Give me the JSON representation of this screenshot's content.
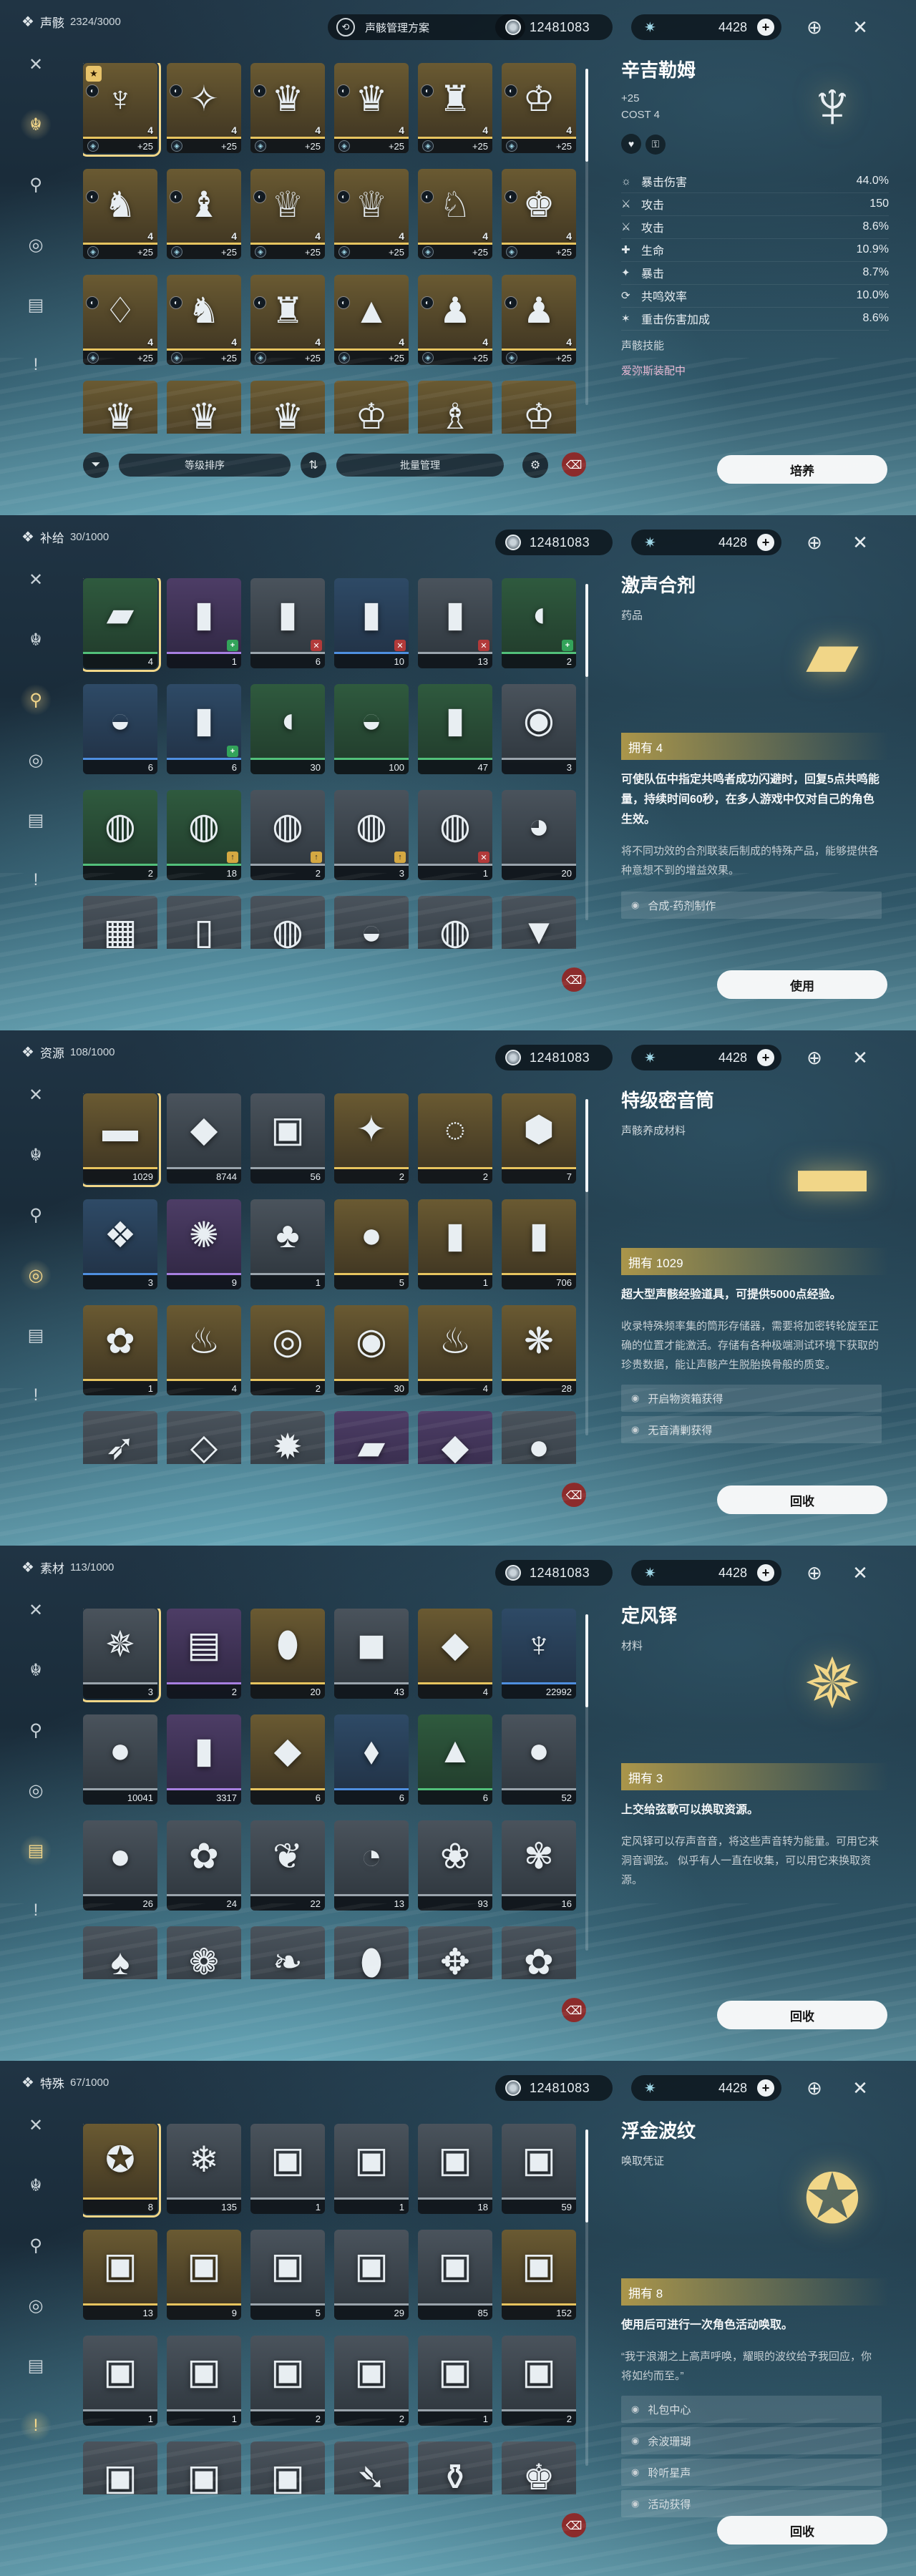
{
  "panels": [
    {
      "category": {
        "icon": "echo-icon",
        "label": "声骸",
        "count": "2324/3000"
      },
      "scheme_label": "声骸管理方案",
      "currency": "12481083",
      "energy": "4428",
      "detail": {
        "name": "辛吉勒姆",
        "level": "+25",
        "cost": "COST 4",
        "stats": [
          {
            "icon": "☼",
            "label": "暴击伤害",
            "value": "44.0%"
          },
          {
            "icon": "⚔",
            "label": "攻击",
            "value": "150"
          },
          {
            "icon": "⚔",
            "label": "攻击",
            "value": "8.6%"
          },
          {
            "icon": "✚",
            "label": "生命",
            "value": "10.9%"
          },
          {
            "icon": "✦",
            "label": "暴击",
            "value": "8.7%"
          },
          {
            "icon": "⟳",
            "label": "共鸣效率",
            "value": "10.0%"
          },
          {
            "icon": "✶",
            "label": "重击伤害加成",
            "value": "8.6%"
          }
        ],
        "skill_label": "声骸技能",
        "equipped": "爱弥斯装配中"
      },
      "bottom": {
        "sort_label": "等级排序",
        "batch_label": "批量管理"
      },
      "action": "培养",
      "items": [
        {
          "q": "q5",
          "art": "♆",
          "cost": "4",
          "lv": "+25",
          "badge": "★",
          "sel": true
        },
        {
          "q": "q5",
          "art": "✧",
          "cost": "4",
          "lv": "+25"
        },
        {
          "q": "q5",
          "art": "♛",
          "cost": "4",
          "lv": "+25"
        },
        {
          "q": "q5",
          "art": "♛",
          "cost": "4",
          "lv": "+25"
        },
        {
          "q": "q5",
          "art": "♜",
          "cost": "4",
          "lv": "+25"
        },
        {
          "q": "q5",
          "art": "♔",
          "cost": "4",
          "lv": "+25"
        },
        {
          "q": "q5",
          "art": "♞",
          "cost": "4",
          "lv": "+25"
        },
        {
          "q": "q5",
          "art": "♝",
          "cost": "4",
          "lv": "+25"
        },
        {
          "q": "q5",
          "art": "♕",
          "cost": "4",
          "lv": "+25"
        },
        {
          "q": "q5",
          "art": "♕",
          "cost": "4",
          "lv": "+25"
        },
        {
          "q": "q5",
          "art": "♘",
          "cost": "4",
          "lv": "+25"
        },
        {
          "q": "q5",
          "art": "♚",
          "cost": "4",
          "lv": "+25"
        },
        {
          "q": "q5",
          "art": "♢",
          "cost": "4",
          "lv": "+25"
        },
        {
          "q": "q5",
          "art": "♞",
          "cost": "4",
          "lv": "+25"
        },
        {
          "q": "q5",
          "art": "♜",
          "cost": "4",
          "lv": "+25"
        },
        {
          "q": "q5",
          "art": "▲",
          "cost": "4",
          "lv": "+25"
        },
        {
          "q": "q5",
          "art": "♟",
          "cost": "4",
          "lv": "+25"
        },
        {
          "q": "q5",
          "art": "♟",
          "cost": "4",
          "lv": "+25"
        },
        {
          "q": "q5",
          "art": "♛",
          "cost": "",
          "": ""
        },
        {
          "q": "q5",
          "art": "♛",
          "cost": ""
        },
        {
          "q": "q5",
          "art": "♛",
          "cost": ""
        },
        {
          "q": "q5",
          "art": "♔",
          "cost": ""
        },
        {
          "q": "q5",
          "art": "♗",
          "cost": ""
        },
        {
          "q": "q5",
          "art": "♔",
          "cost": ""
        }
      ]
    },
    {
      "category": {
        "icon": "supply-icon",
        "label": "补给",
        "count": "30/1000"
      },
      "currency": "12481083",
      "energy": "4428",
      "detail": {
        "name": "激声合剂",
        "sub": "药品",
        "art": "▰",
        "own": "拥有 4",
        "desc": "可使队伍中指定共鸣者成功闪避时，回复5点共鸣能量，持续时间60秒，在多人游戏中仅对自己的角色生效。",
        "lore": "将不同功效的合剂联装后制成的特殊产品，能够提供各种意想不到的增益效果。",
        "sources": [
          "合成-药剂制作"
        ]
      },
      "action": "使用",
      "items": [
        {
          "q": "q2",
          "art": "▰",
          "count": "4",
          "sel": true
        },
        {
          "q": "q4",
          "art": "▮",
          "count": "1",
          "tag": "green"
        },
        {
          "q": "q1",
          "art": "▮",
          "count": "6",
          "tag": "red"
        },
        {
          "q": "q3",
          "art": "▮",
          "count": "10",
          "tag": "red"
        },
        {
          "q": "q1",
          "art": "▮",
          "count": "13",
          "tag": "red"
        },
        {
          "q": "q2",
          "art": "◖",
          "count": "2",
          "tag": "green"
        },
        {
          "q": "q3",
          "art": "◒",
          "count": "6"
        },
        {
          "q": "q3",
          "art": "▮",
          "count": "6",
          "tag": "green"
        },
        {
          "q": "q2",
          "art": "◖",
          "count": "30"
        },
        {
          "q": "q2",
          "art": "◒",
          "count": "100"
        },
        {
          "q": "q2",
          "art": "▮",
          "count": "47"
        },
        {
          "q": "q1",
          "art": "◉",
          "count": "3"
        },
        {
          "q": "q2",
          "art": "◍",
          "count": "2"
        },
        {
          "q": "q2",
          "art": "◍",
          "count": "18",
          "tag": "gold"
        },
        {
          "q": "q1",
          "art": "◍",
          "count": "2",
          "tag": "gold"
        },
        {
          "q": "q1",
          "art": "◍",
          "count": "3",
          "tag": "gold"
        },
        {
          "q": "q1",
          "art": "◍",
          "count": "1",
          "tag": "red"
        },
        {
          "q": "q1",
          "art": "◕",
          "count": "20"
        },
        {
          "q": "q1",
          "art": "▦",
          "count": "",
          "tag": "red"
        },
        {
          "q": "q1",
          "art": "▯",
          "count": ""
        },
        {
          "q": "q1",
          "art": "◍",
          "count": ""
        },
        {
          "q": "q1",
          "art": "◒",
          "count": ""
        },
        {
          "q": "q1",
          "art": "◍",
          "count": ""
        },
        {
          "q": "q1",
          "art": "▼",
          "count": ""
        }
      ]
    },
    {
      "category": {
        "icon": "resource-icon",
        "label": "资源",
        "count": "108/1000"
      },
      "currency": "12481083",
      "energy": "4428",
      "detail": {
        "name": "特级密音筒",
        "sub": "声骸养成材料",
        "art": "▬",
        "own": "拥有 1029",
        "desc": "超大型声骸经验道具，可提供5000点经验。",
        "lore": "收录特殊频率集的筒形存储器，需要将加密转轮旋至正确的位置才能激活。存储有各种极端测试环境下获取的珍贵数据，能让声骸产生脱胎换骨般的质变。",
        "sources": [
          "开启物资箱获得",
          "无音清剿获得"
        ]
      },
      "action": "回收",
      "items": [
        {
          "q": "q5",
          "art": "▬",
          "count": "1029",
          "sel": true
        },
        {
          "q": "q1",
          "art": "◆",
          "count": "8744"
        },
        {
          "q": "q1",
          "art": "▣",
          "count": "56"
        },
        {
          "q": "q5",
          "art": "✦",
          "count": "2"
        },
        {
          "q": "q5",
          "art": "◌",
          "count": "2"
        },
        {
          "q": "q5",
          "art": "⬢",
          "count": "7"
        },
        {
          "q": "q3",
          "art": "❖",
          "count": "3"
        },
        {
          "q": "q4",
          "art": "✺",
          "count": "9"
        },
        {
          "q": "q1",
          "art": "♣",
          "count": "1"
        },
        {
          "q": "q5",
          "art": "●",
          "count": "5"
        },
        {
          "q": "q5",
          "art": "▮",
          "count": "1"
        },
        {
          "q": "q5",
          "art": "▮",
          "count": "706"
        },
        {
          "q": "q5",
          "art": "✿",
          "count": "1"
        },
        {
          "q": "q5",
          "art": "♨",
          "count": "4"
        },
        {
          "q": "q5",
          "art": "◎",
          "count": "2"
        },
        {
          "q": "q5",
          "art": "◉",
          "count": "30"
        },
        {
          "q": "q5",
          "art": "♨",
          "count": "4"
        },
        {
          "q": "q5",
          "art": "❋",
          "count": "28"
        },
        {
          "q": "q1",
          "art": "➶",
          "count": ""
        },
        {
          "q": "q1",
          "art": "◇",
          "count": ""
        },
        {
          "q": "q1",
          "art": "✹",
          "count": ""
        },
        {
          "q": "q4",
          "art": "▰",
          "count": ""
        },
        {
          "q": "q4",
          "art": "◆",
          "count": ""
        },
        {
          "q": "q1",
          "art": "●",
          "count": ""
        }
      ]
    },
    {
      "category": {
        "icon": "material-icon",
        "label": "素材",
        "count": "113/1000"
      },
      "currency": "12481083",
      "energy": "4428",
      "detail": {
        "name": "定风铎",
        "sub": "材料",
        "art": "✵",
        "own": "拥有 3",
        "desc": "上交给弦歌可以换取资源。",
        "lore": "定风铎可以存声音音，将这些声音转为能量。可用它来洞音调弦。\n似乎有人一直在收集，可以用它来换取资源。",
        "sources": []
      },
      "action": "回收",
      "items": [
        {
          "q": "q1",
          "art": "✵",
          "count": "3",
          "sel": true
        },
        {
          "q": "q4",
          "art": "▤",
          "count": "2"
        },
        {
          "q": "q5",
          "art": "⬮",
          "count": "20"
        },
        {
          "q": "q1",
          "art": "◼",
          "count": "43"
        },
        {
          "q": "q5",
          "art": "◆",
          "count": "4"
        },
        {
          "q": "q3",
          "art": "♆",
          "count": "22992"
        },
        {
          "q": "q1",
          "art": "●",
          "count": "10041"
        },
        {
          "q": "q4",
          "art": "▮",
          "count": "3317"
        },
        {
          "q": "q5",
          "art": "◆",
          "count": "6"
        },
        {
          "q": "q3",
          "art": "⬧",
          "count": "6"
        },
        {
          "q": "q2",
          "art": "▲",
          "count": "6"
        },
        {
          "q": "q1",
          "art": "●",
          "count": "52"
        },
        {
          "q": "q1",
          "art": "●",
          "count": "26"
        },
        {
          "q": "q1",
          "art": "✿",
          "count": "24"
        },
        {
          "q": "q1",
          "art": "❦",
          "count": "22"
        },
        {
          "q": "q1",
          "art": "◔",
          "count": "13"
        },
        {
          "q": "q1",
          "art": "❀",
          "count": "93"
        },
        {
          "q": "q1",
          "art": "✾",
          "count": "16"
        },
        {
          "q": "q1",
          "art": "♠",
          "count": ""
        },
        {
          "q": "q1",
          "art": "❁",
          "count": ""
        },
        {
          "q": "q1",
          "art": "❧",
          "count": ""
        },
        {
          "q": "q1",
          "art": "⬮",
          "count": ""
        },
        {
          "q": "q1",
          "art": "✥",
          "count": "",
          "tag": "green"
        },
        {
          "q": "q1",
          "art": "✿",
          "count": ""
        }
      ]
    },
    {
      "category": {
        "icon": "special-icon",
        "label": "特殊",
        "count": "67/1000"
      },
      "currency": "12481083",
      "energy": "4428",
      "detail": {
        "name": "浮金波纹",
        "sub": "唤取凭证",
        "art": "✪",
        "own": "拥有 8",
        "desc": "使用后可进行一次角色活动唤取。",
        "lore": "“我于浪潮之上高声呼唤，耀眼的波纹给予我回应，你将如约而至。”",
        "sources": [
          "礼包中心",
          "余波珊瑚",
          "聆听星声",
          "活动获得"
        ]
      },
      "action": "回收",
      "items": [
        {
          "q": "q5",
          "art": "✪",
          "count": "8",
          "sel": true
        },
        {
          "q": "q1",
          "art": "❄",
          "count": "135"
        },
        {
          "q": "q1",
          "art": "▣",
          "count": "1"
        },
        {
          "q": "q1",
          "art": "▣",
          "count": "1"
        },
        {
          "q": "q1",
          "art": "▣",
          "count": "18"
        },
        {
          "q": "q1",
          "art": "▣",
          "count": "59"
        },
        {
          "q": "q5",
          "art": "▣",
          "count": "13"
        },
        {
          "q": "q5",
          "art": "▣",
          "count": "9"
        },
        {
          "q": "q1",
          "art": "▣",
          "count": "5"
        },
        {
          "q": "q1",
          "art": "▣",
          "count": "29"
        },
        {
          "q": "q1",
          "art": "▣",
          "count": "85"
        },
        {
          "q": "q5",
          "art": "▣",
          "count": "152"
        },
        {
          "q": "q1",
          "art": "▣",
          "count": "1"
        },
        {
          "q": "q1",
          "art": "▣",
          "count": "1"
        },
        {
          "q": "q1",
          "art": "▣",
          "count": "2"
        },
        {
          "q": "q1",
          "art": "▣",
          "count": "2"
        },
        {
          "q": "q1",
          "art": "▣",
          "count": "1"
        },
        {
          "q": "q1",
          "art": "▣",
          "count": "2"
        },
        {
          "q": "q1",
          "art": "▣",
          "count": ""
        },
        {
          "q": "q1",
          "art": "▣",
          "count": ""
        },
        {
          "q": "q1",
          "art": "▣",
          "count": ""
        },
        {
          "q": "q1",
          "art": "➴",
          "count": ""
        },
        {
          "q": "q1",
          "art": "⚱",
          "count": ""
        },
        {
          "q": "q1",
          "art": "♚",
          "count": ""
        }
      ]
    }
  ],
  "sidebar": [
    {
      "icon": "✕",
      "name": "sword-icon"
    },
    {
      "icon": "☬",
      "name": "echo-mask-icon"
    },
    {
      "icon": "⚲",
      "name": "supply-icon"
    },
    {
      "icon": "◎",
      "name": "resource-icon"
    },
    {
      "icon": "▤",
      "name": "material-icon"
    },
    {
      "icon": "!",
      "name": "special-icon"
    }
  ],
  "colors": {
    "gold": "#f1d688",
    "accent": "#9fd8e8",
    "trash": "#8c2b2b"
  }
}
